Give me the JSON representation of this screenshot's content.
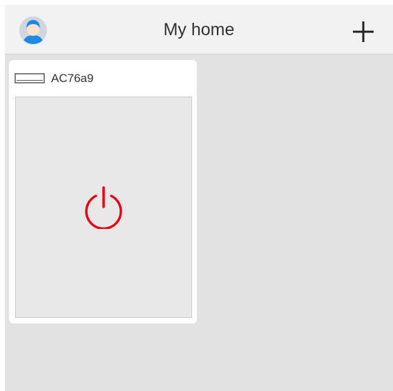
{
  "header": {
    "title": "My home",
    "avatar_icon": "user-avatar-icon",
    "add_icon": "plus-icon"
  },
  "devices": [
    {
      "name": "AC76a9",
      "type_icon": "air-conditioner-icon",
      "power_icon": "power-icon",
      "power_color": "#e60012"
    }
  ],
  "colors": {
    "background": "#e2e2e2",
    "header": "#f2f2f2",
    "card": "#ffffff",
    "panel": "#e8e8e8",
    "avatar_accent": "#1e88e5"
  }
}
